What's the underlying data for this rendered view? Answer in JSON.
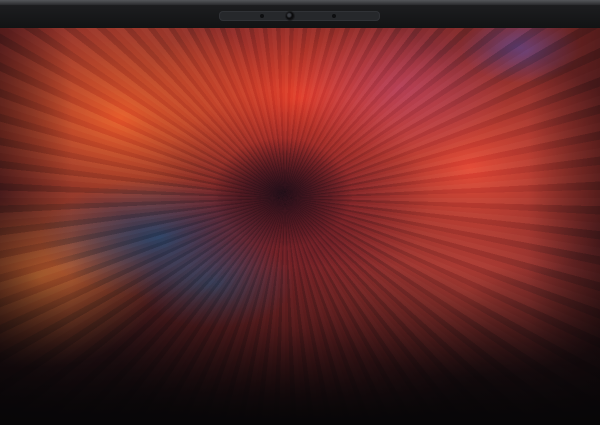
{
  "device": {
    "type": "laptop display",
    "bezel_color": "#141416",
    "camera_housing": "camera-notch"
  },
  "screen": {
    "wallpaper": {
      "description_icon": "abstract-color-explosion-wallpaper",
      "colors": [
        "#f0503c",
        "#e8782d",
        "#2e5a8c",
        "#6a1f2c",
        "#1a0c10"
      ]
    }
  }
}
